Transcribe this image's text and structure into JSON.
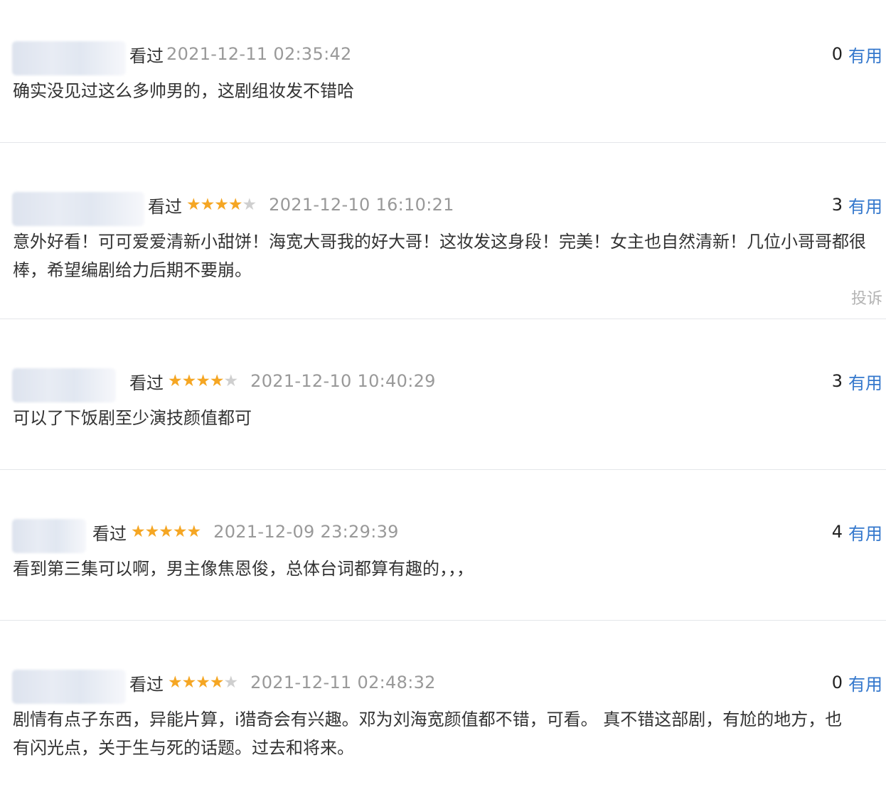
{
  "reviews": [
    {
      "watched": "看过",
      "stars": [],
      "date": "2021-12-11 02:35:42",
      "useful_count": "0",
      "useful_label": "有用",
      "text": "确实没见过这么多帅男的，这剧组妆发不错哈",
      "rating": 0
    },
    {
      "watched": "看过",
      "stars": [
        "★",
        "★",
        "★",
        "★",
        "★"
      ],
      "rating": 4,
      "date": "2021-12-10 16:10:21",
      "useful_count": "3",
      "useful_label": "有用",
      "text": "意外好看！可可爱爱清新小甜饼！海宽大哥我的好大哥！这妆发这身段！完美！女主也自然清新！几位小哥哥都很棒，希望编剧给力后期不要崩。",
      "report": "投诉"
    },
    {
      "watched": "看过",
      "stars": [
        "★",
        "★",
        "★",
        "★",
        "★"
      ],
      "rating": 4,
      "date": "2021-12-10 10:40:29",
      "useful_count": "3",
      "useful_label": "有用",
      "text": "可以了下饭剧至少演技颜值都可"
    },
    {
      "watched": "看过",
      "stars": [
        "★",
        "★",
        "★",
        "★",
        "★"
      ],
      "rating": 5,
      "date": "2021-12-09 23:29:39",
      "useful_count": "4",
      "useful_label": "有用",
      "text": "看到第三集可以啊，男主像焦恩俊，总体台词都算有趣的，，，"
    },
    {
      "watched": "看过",
      "stars": [
        "★",
        "★",
        "★",
        "★",
        "★"
      ],
      "rating": 4,
      "date": "2021-12-11 02:48:32",
      "useful_count": "0",
      "useful_label": "有用",
      "text": "剧情有点子东西，异能片算，i猎奇会有兴趣。邓为刘海宽颜值都不错，可看。 真不错这部剧，有尬的地方，也有闪光点，关于生与死的话题。过去和将来。"
    }
  ],
  "colors": {
    "star_on": "#f5a623",
    "star_off": "#cfcfcf",
    "useful_link": "#3377cc",
    "date": "#999999"
  }
}
